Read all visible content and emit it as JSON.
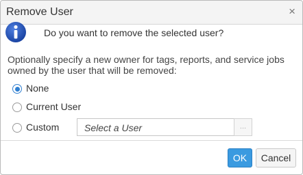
{
  "dialog": {
    "title": "Remove User",
    "close_glyph": "×",
    "icon": "info-icon",
    "question": "Do you want to remove the selected user?",
    "description": "Optionally specify a new owner for tags, reports, and service jobs owned by the user that will be removed:",
    "options": [
      {
        "label": "None",
        "checked": true
      },
      {
        "label": "Current User",
        "checked": false
      },
      {
        "label": "Custom",
        "checked": false
      }
    ],
    "user_select": {
      "placeholder": "Select a User",
      "browse_glyph": "..."
    },
    "buttons": {
      "ok": "OK",
      "cancel": "Cancel"
    }
  },
  "colors": {
    "accent": "#3a9ae0",
    "info_icon": "#1e4fb8",
    "radio_checked": "#2f7fd1"
  }
}
